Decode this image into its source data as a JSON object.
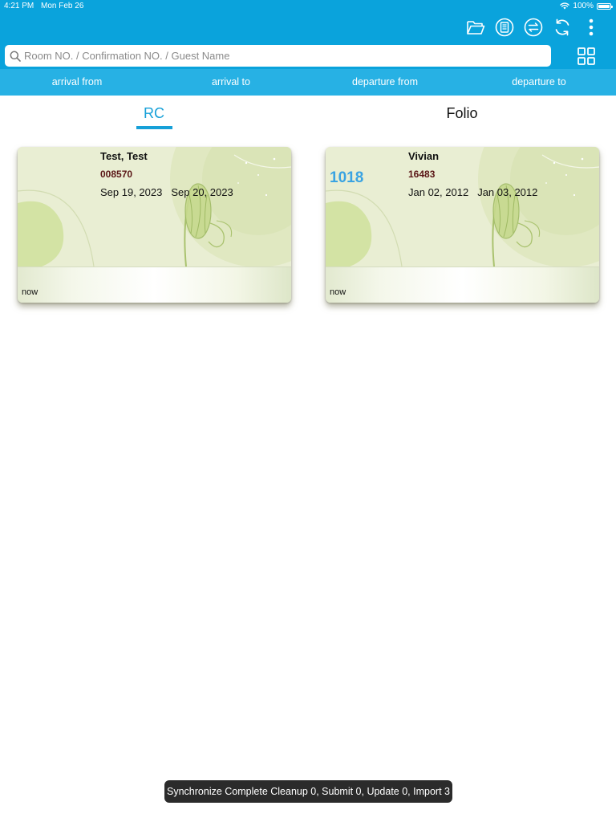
{
  "status_bar": {
    "time": "4:21 PM",
    "date": "Mon Feb 26",
    "battery": "100%",
    "battery_level": 1.0
  },
  "toolbar": {
    "icons": [
      "folder-icon",
      "document-save-icon",
      "swap-icon",
      "refresh-icon",
      "more-vertical-icon"
    ],
    "grid_icon": "grid-view-icon"
  },
  "search": {
    "placeholder": "Room NO. / Confirmation NO. / Guest Name",
    "value": ""
  },
  "filters": [
    "arrival from",
    "arrival to",
    "departure from",
    "departure to"
  ],
  "tabs": {
    "rc": "RC",
    "folio": "Folio",
    "active": "rc"
  },
  "cards": [
    {
      "name": "Test, Test",
      "confirmation": "008570",
      "arrival": "Sep 19, 2023",
      "departure": "Sep 20, 2023",
      "room": "",
      "time": "now"
    },
    {
      "name": "Vivian",
      "confirmation": "16483",
      "arrival": "Jan 02, 2012",
      "departure": "Jan 03, 2012",
      "room": "1018",
      "time": "now"
    }
  ],
  "toast": {
    "message": "Synchronize Complete Cleanup 0, Submit 0, Update 0, Import 3"
  },
  "colors": {
    "header": "#0aa3dc",
    "filter_bar": "#27b1e4",
    "accent": "#16a0d8",
    "room_number": "#3aa3e2",
    "confirmation": "#5a1616"
  }
}
